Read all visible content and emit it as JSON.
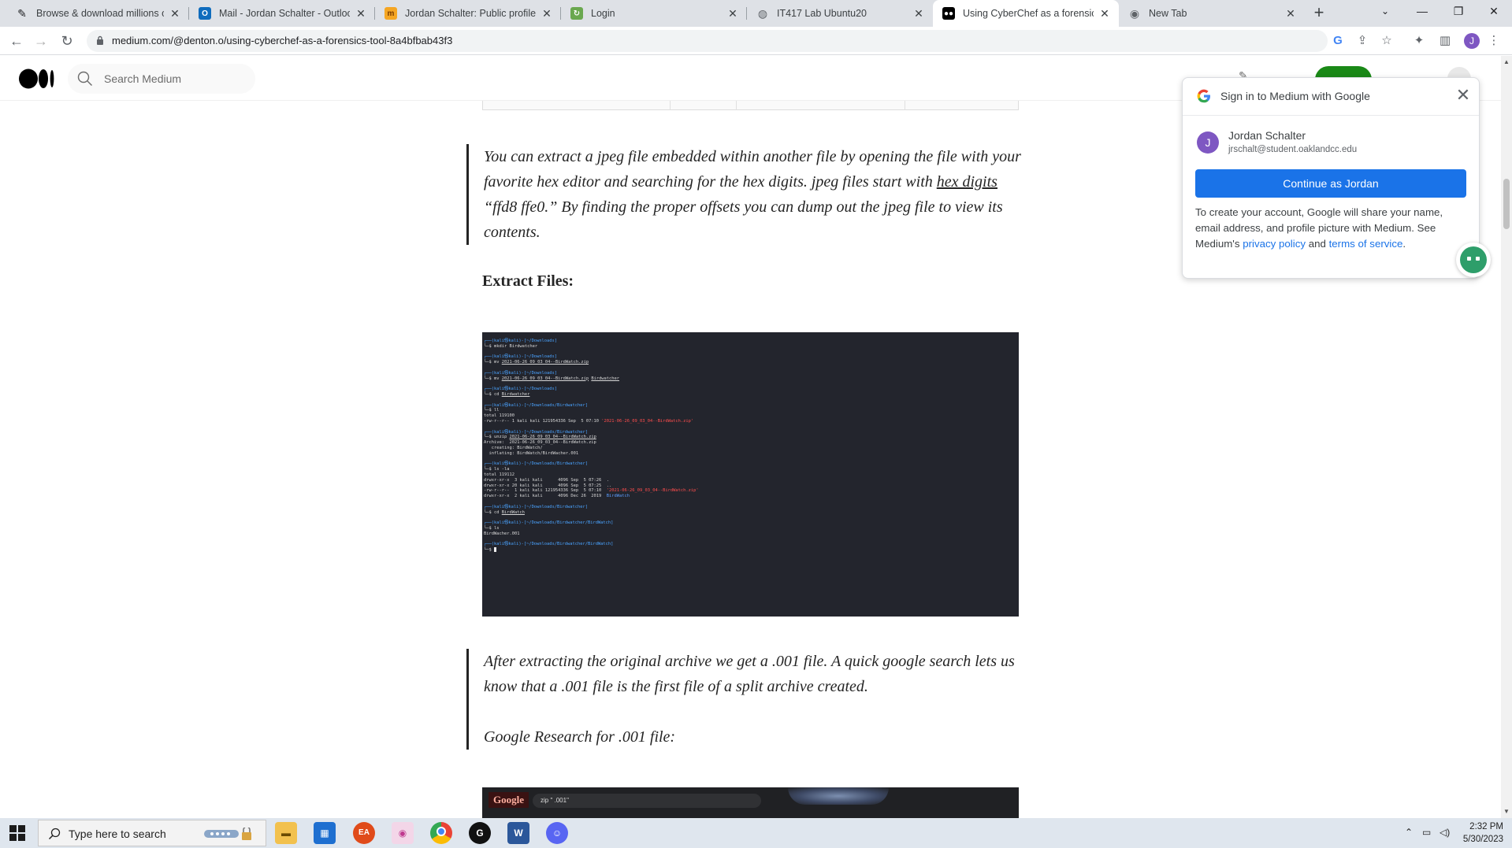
{
  "browser": {
    "tabs": [
      {
        "title": "Browse & download millions of",
        "favicon": "pen-icon"
      },
      {
        "title": "Mail - Jordan Schalter - Outlook",
        "favicon": "outlook-icon"
      },
      {
        "title": "Jordan Schalter: Public profile",
        "favicon": "profile-icon"
      },
      {
        "title": "Login",
        "favicon": "login-icon"
      },
      {
        "title": "IT417 Lab Ubuntu20",
        "favicon": "globe-icon"
      },
      {
        "title": "Using CyberChef as a forensics t",
        "favicon": "medium-icon"
      },
      {
        "title": "New Tab",
        "favicon": "chrome-icon"
      }
    ],
    "url": "medium.com/@denton.o/using-cyberchef-as-a-forensics-tool-8a4bfbab43f3",
    "profile_initial": "J"
  },
  "medium": {
    "search_placeholder": "Search Medium"
  },
  "article": {
    "quote1_a": "You can extract a jpeg file embedded within another file by opening the file with your favorite hex editor and searching for the hex digits. jpeg files start with ",
    "quote1_link": "hex digits",
    "quote1_b": " “ffd8 ffe0.” By finding the proper offsets you can dump out the jpeg file to view its contents.",
    "heading": "Extract Files:",
    "quote2": "After extracting the original archive we get a .001 file. A quick google search lets us know that a .001 file is the first file of a split archive created.",
    "quote2_sub": "Google Research for .001 file:",
    "google_shot": {
      "logo": "Google",
      "query": "zip \" .001\""
    }
  },
  "terminal": {
    "lines": [
      [
        {
          "t": "┌──(kali㉿kali)-[~/Downloads]",
          "c": "p"
        }
      ],
      [
        {
          "t": "└─$ mkdir Birdwatcher"
        }
      ],
      [
        {
          "t": ""
        }
      ],
      [
        {
          "t": "┌──(kali㉿kali)-[~/Downloads]",
          "c": "p"
        }
      ],
      [
        {
          "t": "└─$ mv "
        },
        {
          "t": "2021-06-26_09_03_04--BirdWatch.zip",
          "c": "u"
        }
      ],
      [
        {
          "t": ""
        }
      ],
      [
        {
          "t": "┌──(kali㉿kali)-[~/Downloads]",
          "c": "p"
        }
      ],
      [
        {
          "t": "└─$ mv "
        },
        {
          "t": "2021-06-26_09_03_04--BirdWatch.zip",
          "c": "u"
        },
        {
          "t": " "
        },
        {
          "t": "Birdwatcher",
          "c": "u"
        }
      ],
      [
        {
          "t": ""
        }
      ],
      [
        {
          "t": "┌──(kali㉿kali)-[~/Downloads]",
          "c": "p"
        }
      ],
      [
        {
          "t": "└─$ cd "
        },
        {
          "t": "Birdwatcher",
          "c": "u"
        }
      ],
      [
        {
          "t": ""
        }
      ],
      [
        {
          "t": "┌──(kali㉿kali)-[~/Downloads/Birdwatcher]",
          "c": "p"
        }
      ],
      [
        {
          "t": "└─$ ll"
        }
      ],
      [
        {
          "t": "total 119100"
        }
      ],
      [
        {
          "t": "-rw-r--r-- 1 kali kali 121954336 Sep  5 07:10 "
        },
        {
          "t": "'2021-06-26_09_03_04--BirdWatch.zip'",
          "c": "r"
        }
      ],
      [
        {
          "t": ""
        }
      ],
      [
        {
          "t": "┌──(kali㉿kali)-[~/Downloads/Birdwatcher]",
          "c": "p"
        }
      ],
      [
        {
          "t": "└─$ unzip "
        },
        {
          "t": "2021-06-26_09_03_04--BirdWatch.zip",
          "c": "u"
        }
      ],
      [
        {
          "t": "Archive:  2021-06-26_09_03_04--BirdWatch.zip"
        }
      ],
      [
        {
          "t": "   creating: BirdWatch/"
        }
      ],
      [
        {
          "t": "  inflating: BirdWatch/BirdWacher.001"
        }
      ],
      [
        {
          "t": ""
        }
      ],
      [
        {
          "t": "┌──(kali㉿kali)-[~/Downloads/Birdwatcher]",
          "c": "p"
        }
      ],
      [
        {
          "t": "└─$ ls -la"
        }
      ],
      [
        {
          "t": "total 119112"
        }
      ],
      [
        {
          "t": "drwxr-xr-x  3 kali kali      4096 Sep  5 07:26  ."
        }
      ],
      [
        {
          "t": "drwxr-xr-x 20 kali kali      4096 Sep  5 07:25  .."
        }
      ],
      [
        {
          "t": "-rw-r--r--  1 kali kali 121954336 Sep  5 07:10  "
        },
        {
          "t": "'2021-06-26_09_03_04--BirdWatch.zip'",
          "c": "r"
        }
      ],
      [
        {
          "t": "drwxr-xr-x  2 kali kali      4096 Dec 26  2019  "
        },
        {
          "t": "BirdWatch",
          "c": "b"
        }
      ],
      [
        {
          "t": ""
        }
      ],
      [
        {
          "t": "┌──(kali㉿kali)-[~/Downloads/Birdwatcher]",
          "c": "p"
        }
      ],
      [
        {
          "t": "└─$ cd "
        },
        {
          "t": "BirdWatch",
          "c": "u"
        }
      ],
      [
        {
          "t": ""
        }
      ],
      [
        {
          "t": "┌──(kali㉿kali)-[~/Downloads/Birdwatcher/BirdWatch]",
          "c": "p"
        }
      ],
      [
        {
          "t": "└─$ ls"
        }
      ],
      [
        {
          "t": "BirdWacher.001"
        }
      ],
      [
        {
          "t": ""
        }
      ],
      [
        {
          "t": "┌──(kali㉿kali)-[~/Downloads/Birdwatcher/BirdWatch]",
          "c": "p"
        }
      ],
      [
        {
          "t": "└─$ "
        },
        {
          "t": "",
          "c": "cursor"
        }
      ]
    ]
  },
  "onetap": {
    "title": "Sign in to Medium with Google",
    "account_initial": "J",
    "account_name": "Jordan Schalter",
    "account_email": "jrschalt@student.oaklandcc.edu",
    "cta": "Continue as Jordan",
    "consent_a": "To create your account, Google will share your name, email address, and profile picture with Medium. See Medium's ",
    "privacy_link": "privacy policy",
    "consent_and": " and ",
    "terms_link": "terms of service",
    "consent_end": "."
  },
  "taskbar": {
    "search_placeholder": "Type here to search",
    "apps": [
      "file-explorer-icon",
      "store-icon",
      "ea-icon",
      "media-icon",
      "chrome-icon",
      "github-icon",
      "word-icon",
      "discord-icon"
    ],
    "time": "2:32 PM",
    "date": "5/30/2023"
  }
}
